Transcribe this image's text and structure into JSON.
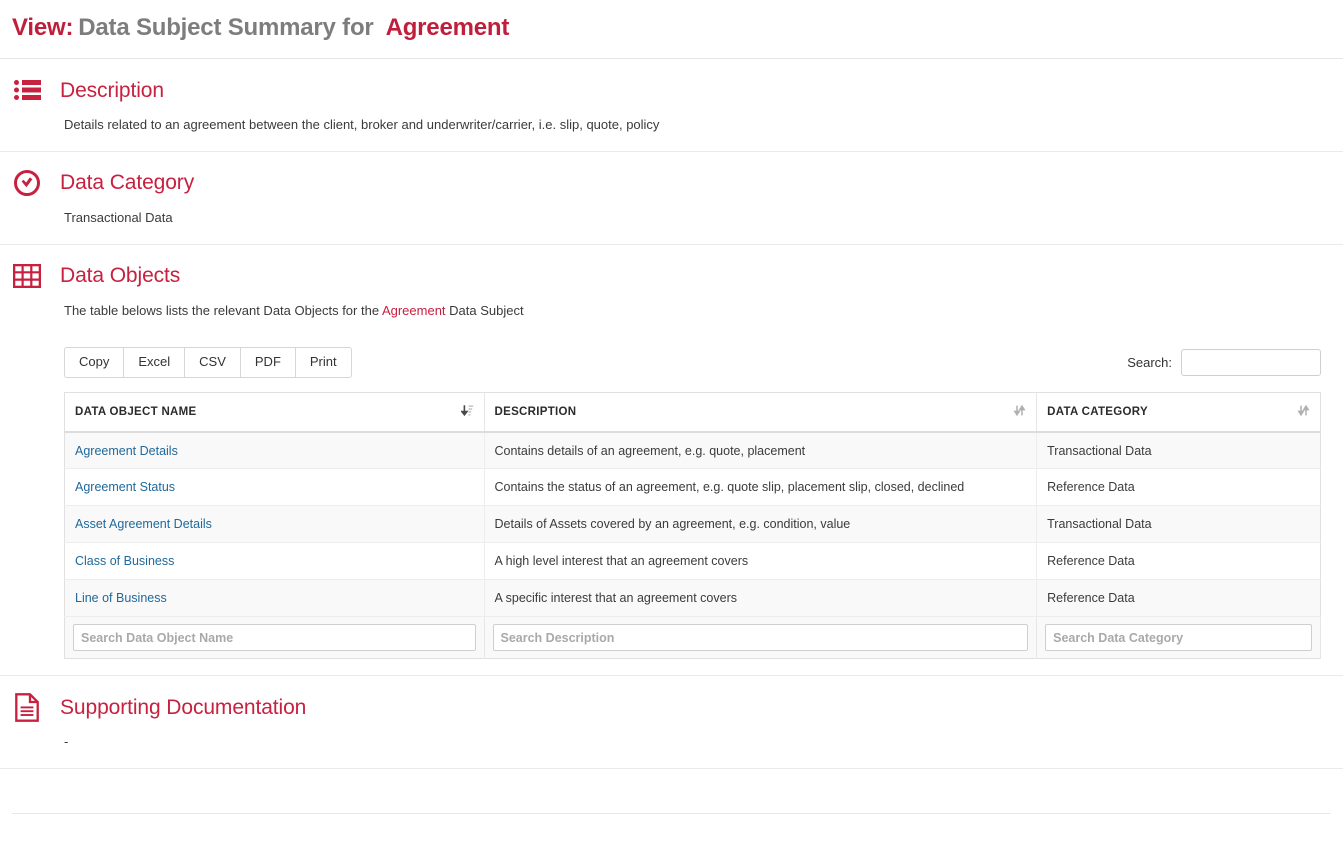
{
  "header": {
    "prefix": "View:",
    "middle": "Data Subject Summary for",
    "entity": "Agreement"
  },
  "colors": {
    "accent": "#c8203f",
    "title_gray": "#7d7d7d",
    "link": "#20699c"
  },
  "sections": {
    "description": {
      "icon": "list-icon",
      "title": "Description",
      "text": "Details related to an agreement between the client, broker and underwriter/carrier, i.e. slip, quote, policy"
    },
    "data_category": {
      "icon": "check-circle-icon",
      "title": "Data Category",
      "text": "Transactional Data"
    },
    "data_objects": {
      "icon": "table-grid-icon",
      "title": "Data Objects",
      "intro_before": "The table belows lists the relevant Data Objects for the ",
      "intro_highlight": "Agreement",
      "intro_after": " Data Subject"
    },
    "supporting_documentation": {
      "icon": "document-icon",
      "title": "Supporting Documentation",
      "text": "-"
    }
  },
  "datatable": {
    "buttons": [
      {
        "label": "Copy",
        "name": "copy-button"
      },
      {
        "label": "Excel",
        "name": "excel-button"
      },
      {
        "label": "CSV",
        "name": "csv-button"
      },
      {
        "label": "PDF",
        "name": "pdf-button"
      },
      {
        "label": "Print",
        "name": "print-button"
      }
    ],
    "search": {
      "label": "Search:",
      "value": "",
      "placeholder": ""
    },
    "columns": [
      {
        "label": "DATA OBJECT NAME",
        "sort": "asc"
      },
      {
        "label": "DESCRIPTION",
        "sort": "none"
      },
      {
        "label": "DATA CATEGORY",
        "sort": "none"
      }
    ],
    "rows": [
      {
        "name": "Agreement Details",
        "description": "Contains details of an agreement, e.g. quote, placement",
        "category": "Transactional Data"
      },
      {
        "name": "Agreement Status",
        "description": "Contains the status of an agreement, e.g. quote slip, placement slip, closed, declined",
        "category": "Reference Data"
      },
      {
        "name": "Asset Agreement Details",
        "description": "Details of Assets covered by an agreement, e.g. condition, value",
        "category": "Transactional Data"
      },
      {
        "name": "Class of Business",
        "description": "A high level interest that an agreement covers",
        "category": "Reference Data"
      },
      {
        "name": "Line of Business",
        "description": "A specific interest that an agreement covers",
        "category": "Reference Data"
      }
    ],
    "filters": [
      {
        "placeholder": "Search Data Object Name",
        "value": ""
      },
      {
        "placeholder": "Search Description",
        "value": ""
      },
      {
        "placeholder": "Search Data Category",
        "value": ""
      }
    ]
  }
}
